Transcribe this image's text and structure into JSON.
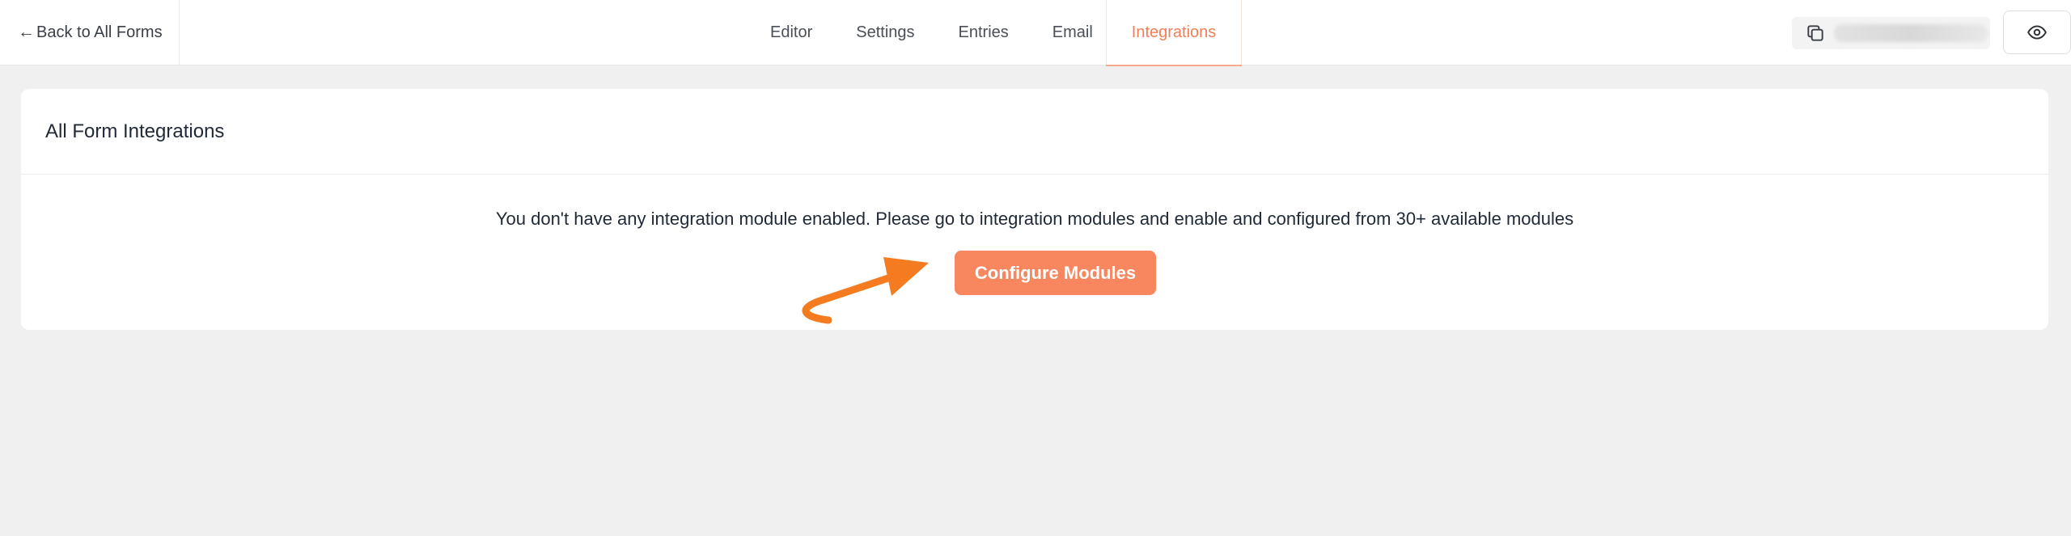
{
  "header": {
    "back_label": "Back to All Forms",
    "tabs": [
      {
        "label": "Editor",
        "active": false
      },
      {
        "label": "Settings",
        "active": false
      },
      {
        "label": "Entries",
        "active": false
      },
      {
        "label": "Email",
        "active": false
      },
      {
        "label": "Integrations",
        "active": true
      }
    ],
    "copy_icon": "copy-icon",
    "preview_icon": "eye-icon"
  },
  "card": {
    "title": "All Form Integrations",
    "message": "You don't have any integration module enabled. Please go to integration modules and enable and configured from 30+ available modules",
    "button_label": "Configure Modules"
  },
  "colors": {
    "accent": "#f17e58",
    "button": "#f88760",
    "annotation_arrow": "#f47b1f",
    "background": "#f0f0f0"
  }
}
